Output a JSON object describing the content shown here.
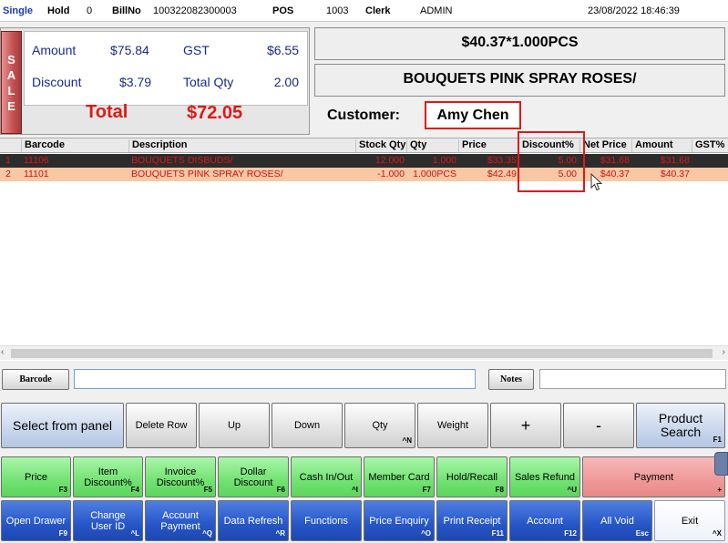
{
  "topbar": {
    "mode": "Single",
    "hold_label": "Hold",
    "hold_value": "0",
    "billno_label": "BillNo",
    "billno_value": "100322082300003",
    "pos_label": "POS",
    "pos_value": "1003",
    "clerk_label": "Clerk",
    "clerk_value": "ADMIN",
    "datetime": "23/08/2022 18:46:39"
  },
  "summary": {
    "sale_tab": [
      "S",
      "A",
      "L",
      "E"
    ],
    "amount_label": "Amount",
    "amount_value": "$75.84",
    "gst_label": "GST",
    "gst_value": "$6.55",
    "discount_label": "Discount",
    "discount_value": "$3.79",
    "total_qty_label": "Total Qty",
    "total_qty_value": "2.00",
    "total_label": "Total",
    "total_value": "$72.05"
  },
  "display": {
    "price_line": "$40.37*1.000PCS",
    "item_line": "BOUQUETS PINK SPRAY ROSES/",
    "customer_label": "Customer:",
    "customer_name": "Amy Chen"
  },
  "grid": {
    "columns": [
      "Barcode",
      "Description",
      "Stock Qty",
      "Qty",
      "Price",
      "Discount%",
      "Net Price",
      "Amount",
      "GST%"
    ],
    "rows": [
      {
        "no": "1",
        "barcode": "11106",
        "description": "BOUQUETS DISBUDS/",
        "stock_qty": "12.000",
        "qty": "1.000",
        "price": "$33.35",
        "discount": "5.00",
        "net_price": "$31.68",
        "amount": "$31.68"
      },
      {
        "no": "2",
        "barcode": "11101",
        "description": "BOUQUETS PINK SPRAY ROSES/",
        "stock_qty": "-1.000",
        "qty": "1.000PCS",
        "price": "$42.49",
        "discount": "5.00",
        "net_price": "$40.37",
        "amount": "$40.37"
      }
    ]
  },
  "input_row": {
    "barcode_button": "Barcode",
    "barcode_value": "",
    "notes_button": "Notes",
    "notes_value": ""
  },
  "row1_buttons": {
    "select_panel": "Select from panel",
    "delete_row": "Delete Row",
    "up": "Up",
    "down": "Down",
    "qty": "Qty",
    "qty_key": "^N",
    "weight": "Weight",
    "plus": "+",
    "minus": "-",
    "product_search": "Product Search",
    "product_search_key": "F1"
  },
  "row2_buttons": [
    {
      "label": "Price",
      "key": "F3"
    },
    {
      "label": "Item Discount%",
      "key": "F4"
    },
    {
      "label": "Invoice Discount%",
      "key": "F5"
    },
    {
      "label": "Dollar Discount",
      "key": "F6"
    },
    {
      "label": "Cash In/Out",
      "key": "^I"
    },
    {
      "label": "Member Card",
      "key": "F7"
    },
    {
      "label": "Hold/Recall",
      "key": "F8"
    },
    {
      "label": "Sales Refund",
      "key": "^U"
    },
    {
      "label": "Payment",
      "key": "+"
    }
  ],
  "row3_buttons": [
    {
      "label": "Open Drawer",
      "key": "F9"
    },
    {
      "label": "Change User ID",
      "key": "^L"
    },
    {
      "label": "Account Payment",
      "key": "^Q"
    },
    {
      "label": "Data Refresh",
      "key": "^R"
    },
    {
      "label": "Functions",
      "key": ""
    },
    {
      "label": "Price Enquiry",
      "key": "^O"
    },
    {
      "label": "Print Receipt",
      "key": "F11"
    },
    {
      "label": "Account",
      "key": "F12"
    },
    {
      "label": "All Void",
      "key": "Esc"
    },
    {
      "label": "Exit",
      "key": "^X"
    }
  ],
  "colors": {
    "accent_red": "#e01818",
    "summary_blue": "#1a2a8c",
    "green_button": "#72e272",
    "navy_button": "#2656c8"
  }
}
